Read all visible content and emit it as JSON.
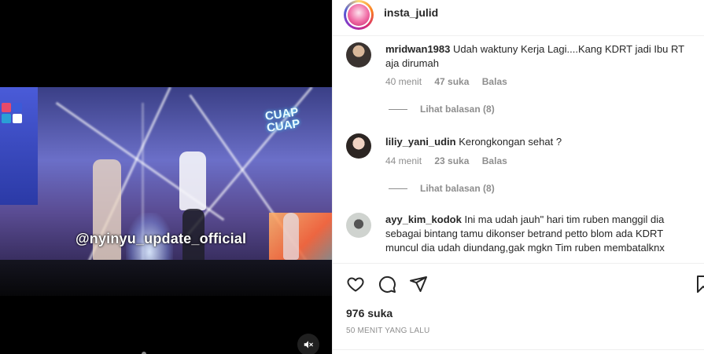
{
  "post": {
    "username": "insta_julid",
    "video_watermark": "@nyinyu_update_official",
    "video_overlay_text": [
      "CUAP",
      "CUAP"
    ]
  },
  "comments": [
    {
      "username": "mridwan1983",
      "text": "Udah waktuny Kerja Lagi....Kang KDRT jadi Ibu RT aja dirumah",
      "time": "40 menit",
      "likes": "47 suka",
      "reply_label": "Balas",
      "view_replies": "Lihat balasan (8)"
    },
    {
      "username": "liliy_yani_udin",
      "text": "Kerongkongan sehat ?",
      "time": "44 menit",
      "likes": "23 suka",
      "reply_label": "Balas",
      "view_replies": "Lihat balasan (8)"
    },
    {
      "username": "ayy_kim_kodok",
      "text": "Ini ma udah jauh\" hari tim ruben manggil dia sebagai bintang tamu dikonser betrand petto blom ada KDRT muncul dia udah diundang,gak mgkn Tim ruben membatalknx"
    }
  ],
  "footer": {
    "likes": "976 suka",
    "posted_time": "50 MENIT YANG LALU"
  },
  "icons": {
    "like": "heart-icon",
    "comment": "comment-icon",
    "share": "send-icon",
    "save": "bookmark-icon",
    "mute": "speaker-muted-icon"
  }
}
